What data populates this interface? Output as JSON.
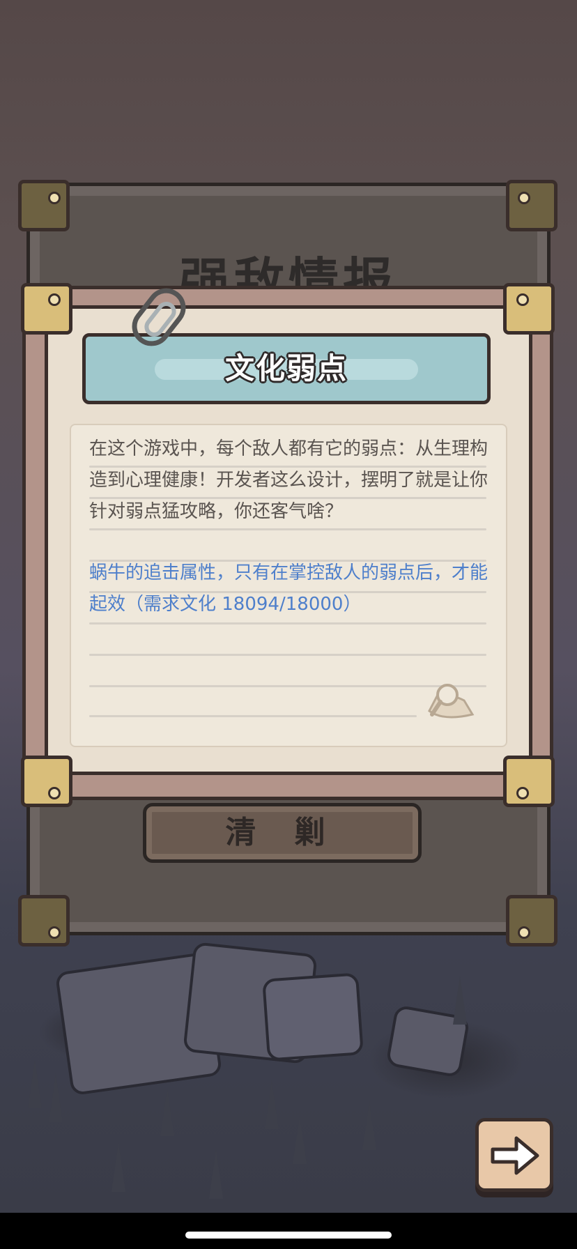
{
  "background": {
    "board_title": "强敌情报",
    "board_button_label": "清 剿"
  },
  "card": {
    "title": "文化弱点",
    "description": "在这个游戏中，每个敌人都有它的弱点：从生理构造到心理健康！开发者这么设计，摆明了就是让你针对弱点猛攻略，你还客气啥？",
    "requirement": "蜗牛的追击属性，只有在掌控敌人的弱点后，才能起效（需求文化  18094/18000）",
    "icon": "magnifier-icon"
  },
  "controls": {
    "next_icon": "arrow-right-icon"
  },
  "colors": {
    "banner": "#9fc8cc",
    "requirement_text": "#4e7fcb",
    "paper": "#e9dfd0",
    "frame": "#b3948a"
  }
}
